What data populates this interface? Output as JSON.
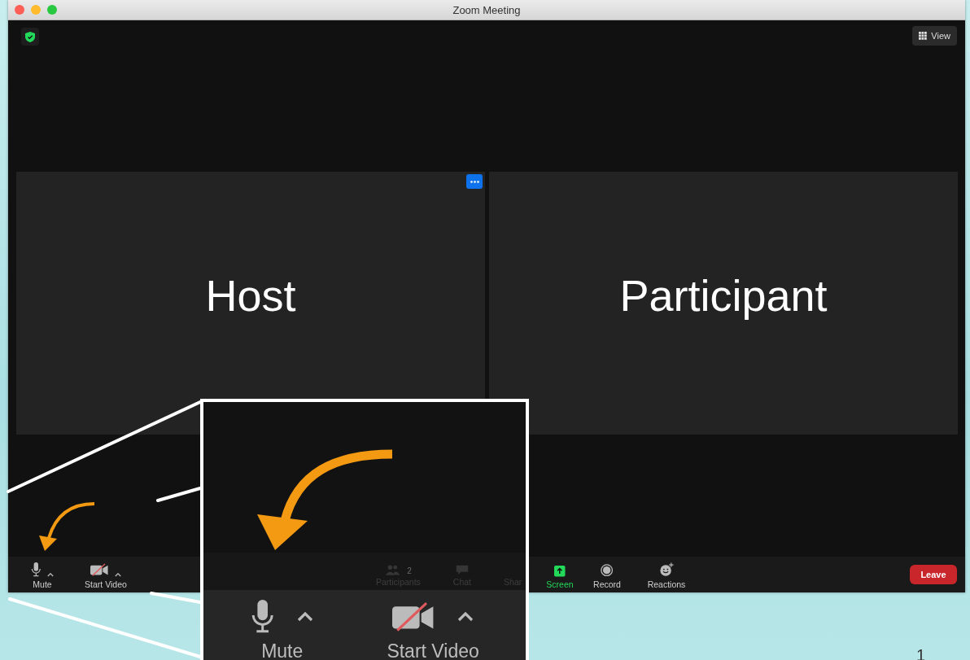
{
  "window": {
    "title": "Zoom Meeting"
  },
  "top_bar": {
    "view_button": "View"
  },
  "tiles": [
    {
      "name": "Host",
      "show_menu": true
    },
    {
      "name": "Participant",
      "show_menu": false
    }
  ],
  "toolbar": {
    "left_items": [
      {
        "label": "Mute",
        "kind": "mic",
        "has_caret": true
      },
      {
        "label": "Start Video",
        "kind": "video_off",
        "has_caret": true
      }
    ],
    "center_items": [
      {
        "label": "Screen",
        "kind": "share"
      },
      {
        "label": "Record",
        "kind": "record"
      },
      {
        "label": "Reactions",
        "kind": "reactions"
      }
    ],
    "leave_button": "Leave"
  },
  "callout": {
    "ghost_items": [
      {
        "label": "Participants",
        "kind": "participants",
        "count": "2"
      },
      {
        "label": "Chat",
        "kind": "chat"
      },
      {
        "label": "Shar",
        "kind": "text"
      }
    ],
    "items": [
      {
        "label": "Mute",
        "kind": "mic",
        "has_caret": true
      },
      {
        "label": "Start Video",
        "kind": "video_off",
        "has_caret": true
      }
    ]
  },
  "slide_number": "1"
}
